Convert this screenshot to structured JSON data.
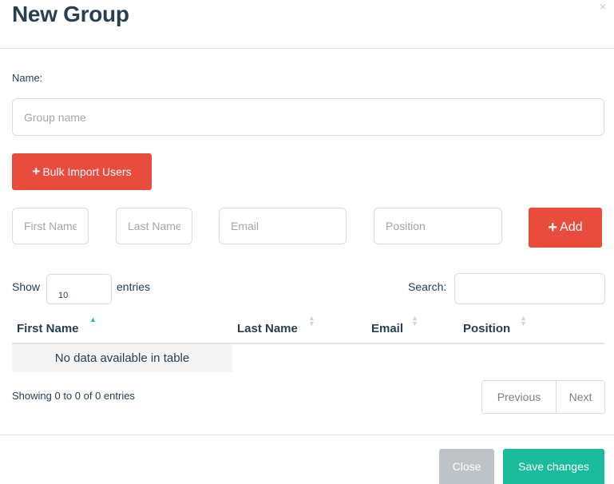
{
  "modal": {
    "title": "New Group",
    "close_glyph": "×"
  },
  "form": {
    "name_label": "Name:",
    "name_placeholder": "Group name",
    "bulk_import_icon": "+",
    "bulk_import_label": "Bulk Import Users",
    "first_name_placeholder": "First Name",
    "last_name_placeholder": "Last Name",
    "email_placeholder": "Email",
    "position_placeholder": "Position",
    "add_icon": "+",
    "add_label": "Add"
  },
  "table": {
    "show_label": "Show",
    "entries_value": "10",
    "entries_label": "entries",
    "search_label": "Search:",
    "columns": [
      "First Name",
      "Last Name",
      "Email",
      "Position"
    ],
    "empty_message": "No data available in table",
    "info": "Showing 0 to 0 of 0 entries",
    "pagination": {
      "previous": "Previous",
      "next": "Next"
    }
  },
  "footer": {
    "close_label": "Close",
    "save_label": "Save changes"
  },
  "colors": {
    "primary_red": "#e74c3c",
    "teal": "#1abc9c",
    "gray_button": "#bdc3c7",
    "heading": "#283f50"
  },
  "icons": [
    "close-icon",
    "plus-icon",
    "sort-asc-icon",
    "sort-both-icon"
  ]
}
